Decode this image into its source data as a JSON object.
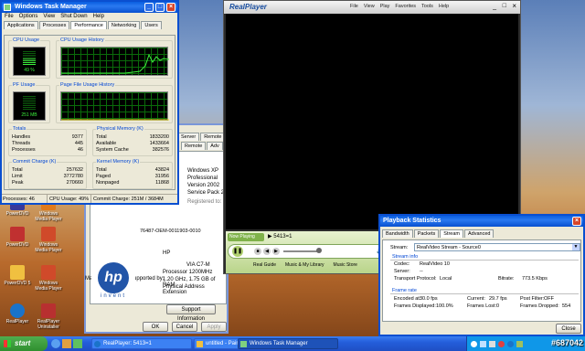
{
  "desktop": {
    "icons": [
      {
        "label": "PowerDVD"
      },
      {
        "label": "Windows Media Player"
      },
      {
        "label": "PowerDVD"
      },
      {
        "label": "Windows Media Player"
      },
      {
        "label": "PowerDVD 5"
      },
      {
        "label": "Windows Media Player"
      },
      {
        "label": "RealPlayer"
      },
      {
        "label": "RealPlayer Uninstaller"
      }
    ]
  },
  "sysprops": {
    "tabs_right": [
      "Server",
      "Remote",
      "Adv"
    ],
    "os": "Windows XP",
    "edition": "Professional",
    "version": "Version 2002",
    "sp": "Service Pack 2",
    "registered": "Registered to:",
    "product_id": "76487-OEM-0011903-0010",
    "manufactured_label": "Manufactured and supported by:",
    "manufacturer": "HP",
    "cpu_brand": "VIA C7-M",
    "cpu": "Processor 1200MHz",
    "mem": "1.20 GHz, 1.75 GB of RAM",
    "pae": "Physical Address Extension",
    "hp_logo": "hp",
    "invent": "invent",
    "support_btn": "Support Information",
    "ok_btn": "OK",
    "cancel_btn": "Cancel",
    "apply_btn": "Apply"
  },
  "taskmgr": {
    "title": "Windows Task Manager",
    "menu": [
      "File",
      "Options",
      "View",
      "Shut Down",
      "Help"
    ],
    "tabs": [
      "Applications",
      "Processes",
      "Performance",
      "Networking",
      "Users"
    ],
    "active_tab": "Performance",
    "cpu_usage_label": "CPU Usage",
    "cpu_value": "49 %",
    "cpu_hist_label": "CPU Usage History",
    "pf_usage_label": "PF Usage",
    "pf_value": "251 MB",
    "pf_hist_label": "Page File Usage History",
    "totals": {
      "label": "Totals",
      "rows": [
        [
          "Handles",
          "9377"
        ],
        [
          "Threads",
          "445"
        ],
        [
          "Processes",
          "46"
        ]
      ]
    },
    "physmem": {
      "label": "Physical Memory (K)",
      "rows": [
        [
          "Total",
          "1833200"
        ],
        [
          "Available",
          "1433664"
        ],
        [
          "System Cache",
          "382576"
        ]
      ]
    },
    "commit": {
      "label": "Commit Charge (K)",
      "rows": [
        [
          "Total",
          "257632"
        ],
        [
          "Limit",
          "3772780"
        ],
        [
          "Peak",
          "270660"
        ]
      ]
    },
    "kernel": {
      "label": "Kernel Memory (K)",
      "rows": [
        [
          "Total",
          "43824"
        ],
        [
          "Paged",
          "31956"
        ],
        [
          "Nonpaged",
          "11868"
        ]
      ]
    },
    "status": {
      "processes": "Processes: 46",
      "cpu": "CPU Usage: 49%",
      "commit": "Commit Charge: 251M / 3684M"
    }
  },
  "realplayer": {
    "logo": "RealPlayer",
    "menu": [
      "File",
      "View",
      "Play",
      "Favorites",
      "Tools",
      "Help"
    ],
    "now_playing": "Now Playing",
    "track": "5413=1",
    "links": [
      "Real Guide",
      "Music & My Library",
      "Music Store"
    ]
  },
  "playback": {
    "title": "Playback Statistics",
    "tabs": [
      "Bandwidth",
      "Packets",
      "Stream",
      "Advanced"
    ],
    "active_tab": "Stream",
    "stream_label": "Stream:",
    "stream_value": "RealVideo Stream - Source0",
    "stream_info_label": "Stream info",
    "codec_label": "Codec:",
    "codec_value": "RealVideo 10",
    "server_label": "Server:",
    "server_value": "--",
    "transport_label": "Transport Protocol:",
    "transport_value": "Local",
    "bitrate_label": "Bitrate:",
    "bitrate_value": "773.5 Kbps",
    "frame_rate_label": "Frame rate",
    "encoded_label": "Encoded at:",
    "encoded_value": "30.0 fps",
    "current_label": "Current:",
    "current_value": "29.7 fps",
    "post_filter_label": "Post Filter:",
    "post_filter_value": "OFF",
    "displayed_label": "Frames Displayed:",
    "displayed_value": "100.0%",
    "lost_label": "Frames Lost:",
    "lost_value": "0",
    "dropped_label": "Frames Dropped:",
    "dropped_value": "554",
    "close_btn": "Close"
  },
  "taskbar": {
    "start": "start",
    "items": [
      "RealPlayer: 5413=1",
      "untitled - Paint",
      "Windows Task Manager"
    ],
    "watermark": "#687042"
  }
}
